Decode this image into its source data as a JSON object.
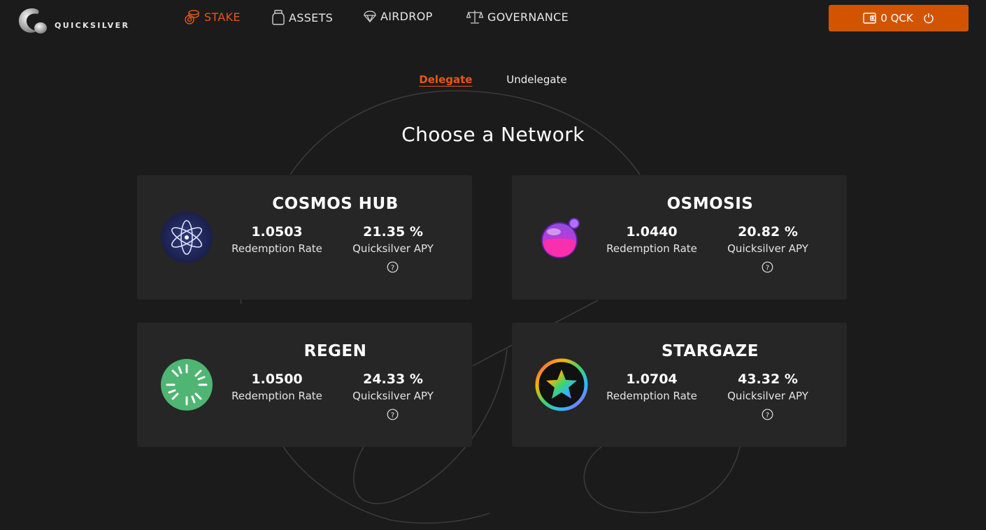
{
  "app": {
    "name": "QUICKSILVER",
    "brand_color": "#d35400"
  },
  "nav": {
    "items": [
      {
        "label": "STAKE",
        "icon": "coins-icon",
        "active": true
      },
      {
        "label": "ASSETS",
        "icon": "jar-icon",
        "active": false
      },
      {
        "label": "AIRDROP",
        "icon": "parachute-icon",
        "active": false
      },
      {
        "label": "GOVERNANCE",
        "icon": "scales-icon",
        "active": false
      }
    ]
  },
  "wallet": {
    "balance": "0 QCK",
    "icon": "wallet-icon",
    "power_icon": "power-icon"
  },
  "tabs": [
    {
      "label": "Delegate",
      "active": true
    },
    {
      "label": "Undelegate",
      "active": false
    }
  ],
  "heading": "Choose a Network",
  "networks": [
    {
      "name": "COSMOS HUB",
      "rate": "1.0503",
      "rate_label": "Redemption Rate",
      "apy": "21.35 %",
      "apy_label": "Quicksilver APY",
      "icon": "cosmos-atom-icon"
    },
    {
      "name": "OSMOSIS",
      "rate": "1.0440",
      "rate_label": "Redemption Rate",
      "apy": "20.82 %",
      "apy_label": "Quicksilver APY",
      "icon": "osmosis-potion-icon"
    },
    {
      "name": "REGEN",
      "rate": "1.0500",
      "rate_label": "Redemption Rate",
      "apy": "24.33 %",
      "apy_label": "Quicksilver APY",
      "icon": "regen-burst-icon"
    },
    {
      "name": "STARGAZE",
      "rate": "1.0704",
      "rate_label": "Redemption Rate",
      "apy": "43.32 %",
      "apy_label": "Quicksilver APY",
      "icon": "stargaze-star-icon"
    }
  ]
}
